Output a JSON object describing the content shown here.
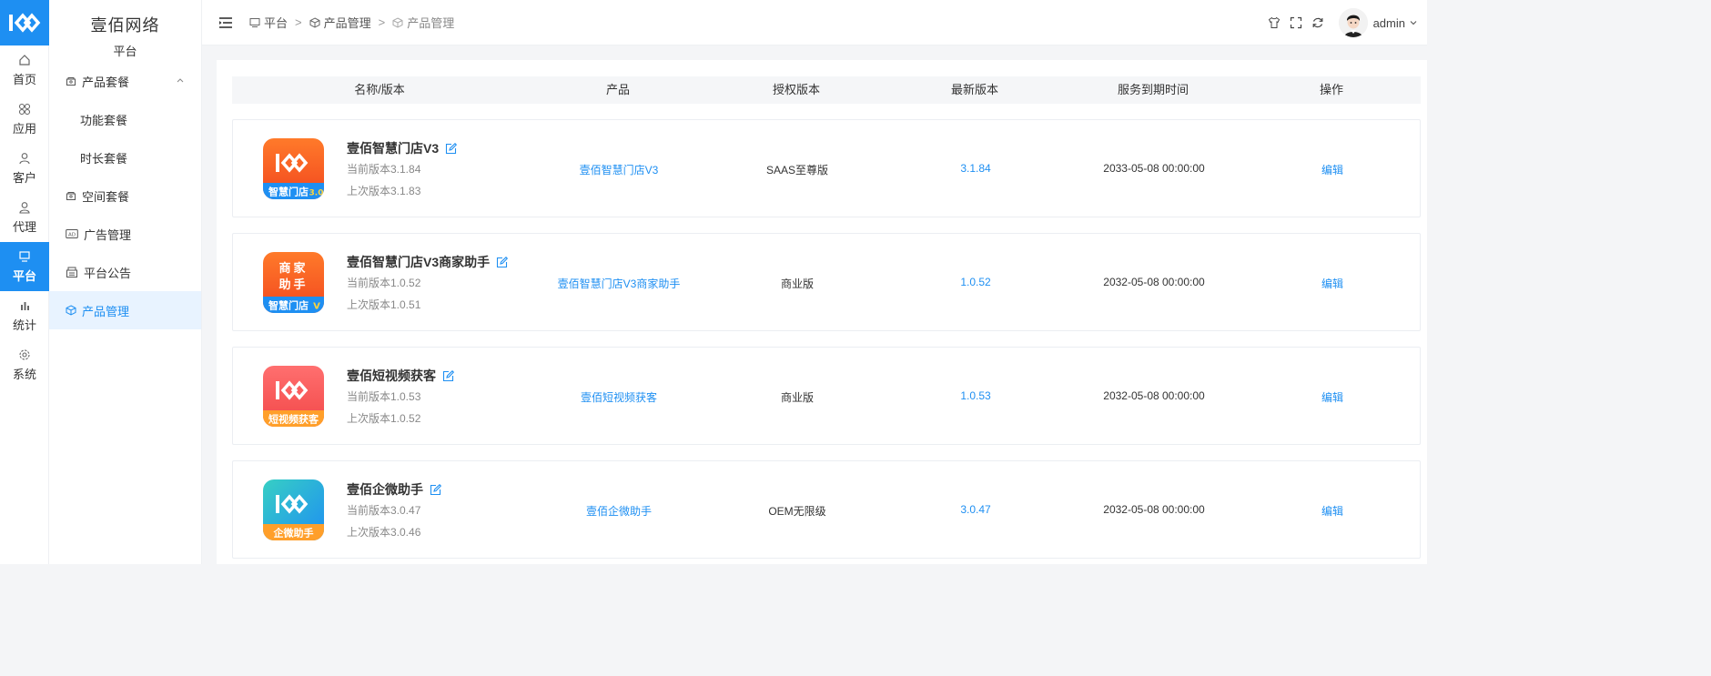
{
  "brand": {
    "name": "壹佰网络",
    "section": "平台"
  },
  "rail": [
    {
      "label": "首页",
      "icon": "home-icon"
    },
    {
      "label": "应用",
      "icon": "apps-icon"
    },
    {
      "label": "客户",
      "icon": "user-icon"
    },
    {
      "label": "代理",
      "icon": "agent-icon"
    },
    {
      "label": "平台",
      "icon": "monitor-icon",
      "active": true
    },
    {
      "label": "统计",
      "icon": "chart-icon"
    },
    {
      "label": "系统",
      "icon": "settings-icon"
    }
  ],
  "submenu": [
    {
      "label": "产品套餐",
      "icon": "package-icon",
      "expanded": true
    },
    {
      "label": "功能套餐",
      "child": true
    },
    {
      "label": "时长套餐",
      "child": true
    },
    {
      "label": "空间套餐",
      "icon": "package-icon"
    },
    {
      "label": "广告管理",
      "icon": "ad-icon"
    },
    {
      "label": "平台公告",
      "icon": "notice-icon"
    },
    {
      "label": "产品管理",
      "icon": "cube-icon",
      "active": true
    }
  ],
  "breadcrumb": [
    "平台",
    "产品管理",
    "产品管理"
  ],
  "user": {
    "name": "admin"
  },
  "table": {
    "headers": [
      "名称/版本",
      "产品",
      "授权版本",
      "最新版本",
      "服务到期时间",
      "操作"
    ],
    "rows": [
      {
        "name": "壹佰智慧门店V3",
        "current": "当前版本3.1.84",
        "previous": "上次版本3.1.83",
        "product": "壹佰智慧门店V3",
        "license": "SAAS至尊版",
        "latest": "3.1.84",
        "expire": "2033-05-08 00:00:00",
        "action": "编辑",
        "icon_text": "智慧门店",
        "icon_badge": "3.0",
        "icon_top": "#ff7a2a",
        "icon_bottom": "#f2471f",
        "strip": "#1e8ff2",
        "mark": "logo"
      },
      {
        "name": "壹佰智慧门店V3商家助手",
        "current": "当前版本1.0.52",
        "previous": "上次版本1.0.51",
        "product": "壹佰智慧门店V3商家助手",
        "license": "商业版",
        "latest": "1.0.52",
        "expire": "2032-05-08 00:00:00",
        "action": "编辑",
        "icon_text": "智慧门店",
        "icon_badge": "V",
        "icon_top": "#ff7a2a",
        "icon_bottom": "#f2471f",
        "strip": "#1e8ff2",
        "mark": "text",
        "icon_mark_1": "商家",
        "icon_mark_2": "助手"
      },
      {
        "name": "壹佰短视频获客",
        "current": "当前版本1.0.53",
        "previous": "上次版本1.0.52",
        "product": "壹佰短视频获客",
        "license": "商业版",
        "latest": "1.0.53",
        "expire": "2032-05-08 00:00:00",
        "action": "编辑",
        "icon_text": "短视频获客",
        "icon_badge": "",
        "icon_top": "#ff6f6f",
        "icon_bottom": "#f24848",
        "strip": "#ff9f2a",
        "mark": "logo"
      },
      {
        "name": "壹佰企微助手",
        "current": "当前版本3.0.47",
        "previous": "上次版本3.0.46",
        "product": "壹佰企微助手",
        "license": "OEM无限级",
        "latest": "3.0.47",
        "expire": "2032-05-08 00:00:00",
        "action": "编辑",
        "icon_text": "企微助手",
        "icon_badge": "",
        "icon_top": "#37cfc4",
        "icon_bottom": "#1e8ff2",
        "strip": "#ff9f2a",
        "mark": "logo"
      }
    ]
  }
}
